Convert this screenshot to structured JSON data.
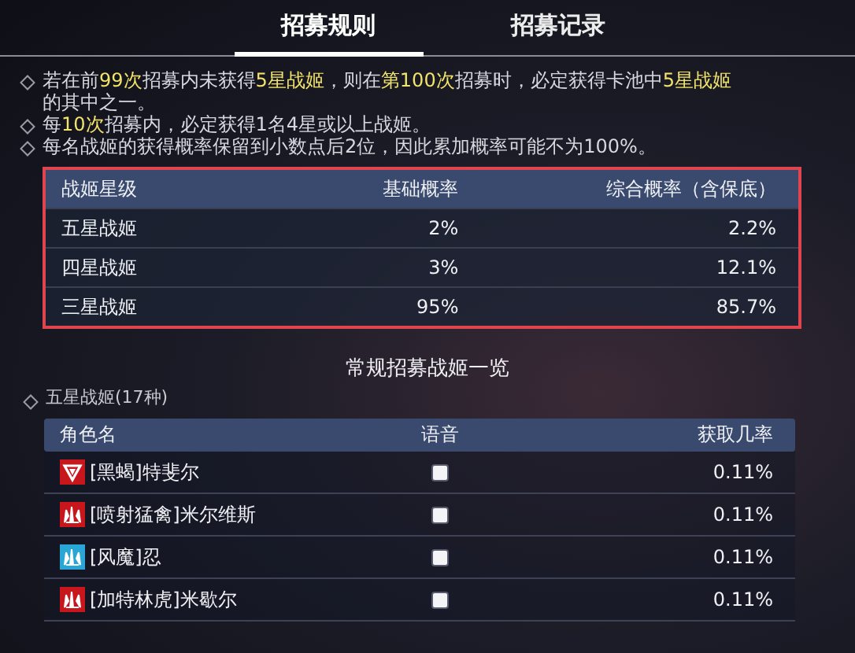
{
  "tabs": [
    {
      "label": "招募规则",
      "selected": true
    },
    {
      "label": "招募记录",
      "selected": false
    }
  ],
  "rules": [
    {
      "segments": [
        {
          "text": "若在前",
          "highlight": false
        },
        {
          "text": "99次",
          "highlight": true
        },
        {
          "text": "招募内未获得",
          "highlight": false
        },
        {
          "text": "5星战姬",
          "highlight": true
        },
        {
          "text": "，则在",
          "highlight": false
        },
        {
          "text": "第100次",
          "highlight": true
        },
        {
          "text": "招募时，必定获得卡池中",
          "highlight": false
        },
        {
          "text": "5星战姬",
          "highlight": true
        },
        {
          "text": "的其中之一。",
          "highlight": false
        }
      ]
    },
    {
      "segments": [
        {
          "text": "每",
          "highlight": false
        },
        {
          "text": "10次",
          "highlight": true
        },
        {
          "text": "招募内，必定获得1名4星或以上战姬。",
          "highlight": false
        }
      ]
    },
    {
      "segments": [
        {
          "text": "每名战姬的获得概率保留到小数点后2位，因此累加概率可能不为100%。",
          "highlight": false
        }
      ]
    }
  ],
  "rate_table": {
    "columns": [
      "战姬星级",
      "基础概率",
      "综合概率（含保底）"
    ],
    "rows": [
      [
        "五星战姬",
        "2%",
        "2.2%"
      ],
      [
        "四星战姬",
        "3%",
        "12.1%"
      ],
      [
        "三星战姬",
        "95%",
        "85.7%"
      ]
    ]
  },
  "roster": {
    "title": "常规招募战姬一览",
    "section": "五星战姬(17种)",
    "columns": [
      "角色名",
      "语音",
      "获取几率"
    ],
    "rows": [
      {
        "name": "[黑蝎]特斐尔",
        "kind": "triangle",
        "color": "#c8161d",
        "rate": "0.11%"
      },
      {
        "name": "[喷射猛禽]米尔维斯",
        "kind": "spikes",
        "color": "#c8161d",
        "rate": "0.11%"
      },
      {
        "name": "[风魔]忍",
        "kind": "spikes",
        "color": "#2aa6d6",
        "rate": "0.11%"
      },
      {
        "name": "[加特林虎]米歇尔",
        "kind": "spikes",
        "color": "#c8161d",
        "rate": "0.11%"
      }
    ]
  }
}
